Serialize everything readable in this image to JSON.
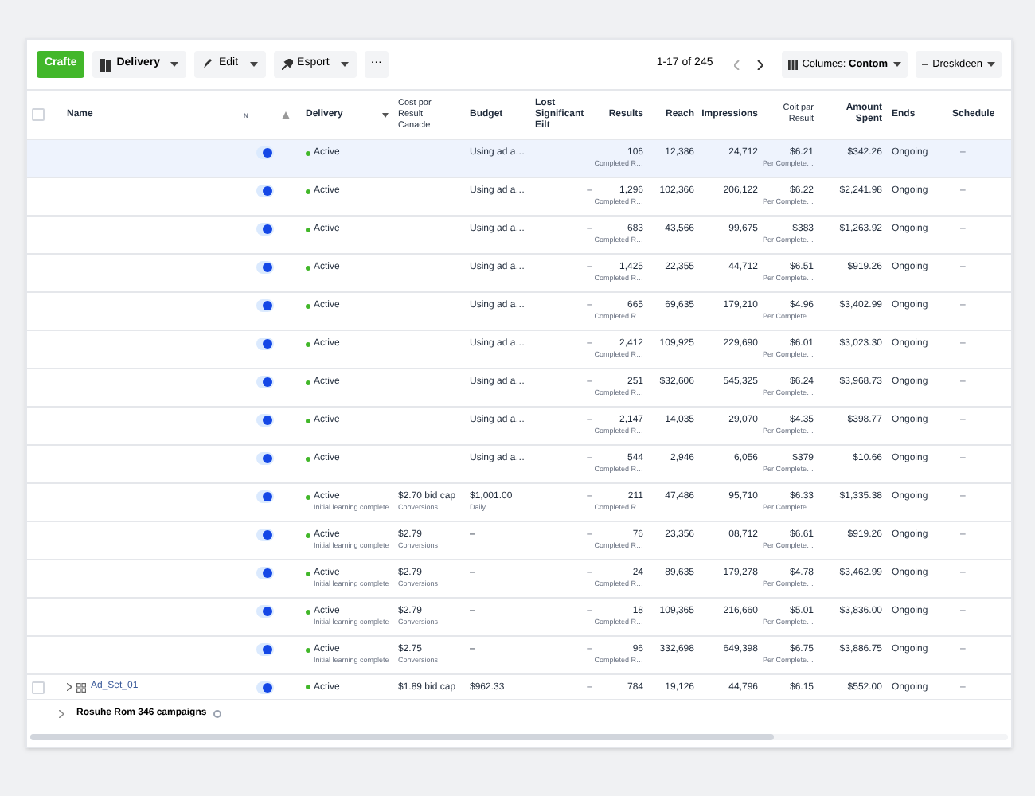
{
  "toolbar": {
    "create": "Crafte",
    "buttons": [
      {
        "kind": "doc",
        "label": "Delivery"
      },
      {
        "kind": "pencil",
        "label": "Edit"
      },
      {
        "kind": "pin",
        "label": "Esport"
      }
    ],
    "more": "···",
    "range": "1-17 of 245",
    "columns_button": "Columes: **Contom**",
    "breakdown_button": "Dreskdeen"
  },
  "columns": [
    {
      "kind": "check",
      "checked": false
    },
    {
      "kind": "text",
      "label": "Name"
    },
    {
      "kind": "text",
      "label": "N"
    },
    {
      "kind": "triangle"
    },
    {
      "kind": "sort",
      "label": "Delivery"
    },
    {
      "kind": "text",
      "label": "Cost por Result Canacle"
    },
    {
      "kind": "text",
      "label": "Budget"
    },
    {
      "kind": "text",
      "label": "Lost Significant Eilt"
    },
    {
      "kind": "text",
      "label": "Results"
    },
    {
      "kind": "text",
      "label": "Reach"
    },
    {
      "kind": "text",
      "label": "Impressions"
    },
    {
      "kind": "text",
      "label": "Coit par Result"
    },
    {
      "kind": "text",
      "label": "Amount Spent"
    },
    {
      "kind": "text",
      "label": "Ends"
    },
    {
      "kind": "text",
      "label": "Schedule"
    }
  ],
  "rows": [
    {
      "selected": true,
      "on": true,
      "delivery": "Active",
      "budget": "Using ad a…",
      "results": "106",
      "results_sub": "Completed R…",
      "reach": "12,386",
      "impressions": "24,712",
      "cpr": "$6.21",
      "cpr_sub": "Per Complete…",
      "amount": "$342.26",
      "ends": "Ongoing",
      "schedule": "–"
    },
    {
      "selected": false,
      "on": true,
      "delivery": "Active",
      "budget": "Using ad a…",
      "lost": "–",
      "results": "1,296",
      "results_sub": "Completed R…",
      "reach": "102,366",
      "impressions": "206,122",
      "cpr": "$6.22",
      "cpr_sub": "Per Complete…",
      "amount": "$2,241.98",
      "ends": "Ongoing",
      "schedule": "–"
    },
    {
      "selected": false,
      "on": true,
      "delivery": "Active",
      "budget": "Using ad a…",
      "lost": "–",
      "results": "683",
      "results_sub": "Completed R…",
      "reach": "43,566",
      "impressions": "99,675",
      "cpr": "$383",
      "cpr_sub": "Per Complete…",
      "amount": "$1,263.92",
      "ends": "Ongoing",
      "schedule": "–"
    },
    {
      "selected": false,
      "on": true,
      "delivery": "Active",
      "budget": "Using ad a…",
      "lost": "–",
      "results": "1,425",
      "results_sub": "Completed R…",
      "reach": "22,355",
      "impressions": "44,712",
      "cpr": "$6.51",
      "cpr_sub": "Per Complete…",
      "amount": "$919.26",
      "ends": "Ongoing",
      "schedule": "–"
    },
    {
      "selected": false,
      "on": true,
      "delivery": "Active",
      "budget": "Using ad a…",
      "lost": "–",
      "results": "665",
      "results_sub": "Completed R…",
      "reach": "69,635",
      "impressions": "179,210",
      "cpr": "$4.96",
      "cpr_sub": "Per Complete…",
      "amount": "$3,402.99",
      "ends": "Ongoing",
      "schedule": "–"
    },
    {
      "selected": false,
      "on": true,
      "delivery": "Active",
      "budget": "Using ad a…",
      "lost": "–",
      "results": "2,412",
      "results_sub": "Completed R…",
      "reach": "109,925",
      "impressions": "229,690",
      "cpr": "$6.01",
      "cpr_sub": "Per Complete…",
      "amount": "$3,023.30",
      "ends": "Ongoing",
      "schedule": "–"
    },
    {
      "selected": false,
      "on": true,
      "delivery": "Active",
      "budget": "Using ad a…",
      "lost": "–",
      "results": "251",
      "results_sub": "Completed R…",
      "reach": "$32,606",
      "impressions": "545,325",
      "cpr": "$6.24",
      "cpr_sub": "Per Complete…",
      "amount": "$3,968.73",
      "ends": "Ongoing",
      "schedule": "–"
    },
    {
      "selected": false,
      "on": true,
      "delivery": "Active",
      "budget": "Using ad a…",
      "lost": "–",
      "results": "2,147",
      "results_sub": "Completed R…",
      "reach": "14,035",
      "impressions": "29,070",
      "cpr": "$4.35",
      "cpr_sub": "Per Complete…",
      "amount": "$398.77",
      "ends": "Ongoing",
      "schedule": "–"
    },
    {
      "selected": false,
      "on": true,
      "delivery": "Active",
      "budget": "Using ad a…",
      "lost": "–",
      "results": "544",
      "results_sub": "Completed R…",
      "reach": "2,946",
      "impressions": "6,056",
      "cpr": "$379",
      "cpr_sub": "Per Complete…",
      "amount": "$10.66",
      "ends": "Ongoing",
      "schedule": "–"
    },
    {
      "selected": false,
      "on": true,
      "delivery": "Active",
      "delivery_sub": "Initial learning complete",
      "cost": "$2.70 bid cap",
      "cost_sub": "Conversions",
      "budget": "$1,001.00",
      "budget_sub": "Daily",
      "lost": "–",
      "results": "211",
      "results_sub": "Completed R…",
      "reach": "47,486",
      "impressions": "95,710",
      "cpr": "$6.33",
      "cpr_sub": "Per Complete…",
      "amount": "$1,335.38",
      "ends": "Ongoing",
      "schedule": "–"
    },
    {
      "selected": false,
      "on": true,
      "delivery": "Active",
      "delivery_sub": "Initial learning complete",
      "cost": "$2.79",
      "cost_sub": "Conversions",
      "budget": "–",
      "lost": "–",
      "results": "76",
      "results_sub": "Completed R…",
      "reach": "23,356",
      "impressions": "08,712",
      "cpr": "$6.61",
      "cpr_sub": "Per Complete…",
      "amount": "$919.26",
      "ends": "Ongoing",
      "schedule": "–"
    },
    {
      "selected": false,
      "on": true,
      "delivery": "Active",
      "delivery_sub": "Initial learning complete",
      "cost": "$2.79",
      "cost_sub": "Conversions",
      "budget": "–",
      "lost": "–",
      "results": "24",
      "results_sub": "Completed R…",
      "reach": "89,635",
      "impressions": "179,278",
      "cpr": "$4.78",
      "cpr_sub": "Per Complete…",
      "amount": "$3,462.99",
      "ends": "Ongoing",
      "schedule": "–"
    },
    {
      "selected": false,
      "on": true,
      "delivery": "Active",
      "delivery_sub": "Initial learning complete",
      "cost": "$2.79",
      "cost_sub": "Conversions",
      "budget": "–",
      "lost": "–",
      "results": "18",
      "results_sub": "Completed R…",
      "reach": "109,365",
      "impressions": "216,660",
      "cpr": "$5.01",
      "cpr_sub": "Per Complete…",
      "amount": "$3,836.00",
      "ends": "Ongoing",
      "schedule": "–"
    },
    {
      "selected": false,
      "on": true,
      "delivery": "Active",
      "delivery_sub": "Initial learning complete",
      "cost": "$2.75",
      "cost_sub": "Conversions",
      "budget": "–",
      "lost": "–",
      "results": "96",
      "results_sub": "Completed R…",
      "reach": "332,698",
      "impressions": "649,398",
      "cpr": "$6.75",
      "cpr_sub": "Per Complete…",
      "amount": "$3,886.75",
      "ends": "Ongoing",
      "schedule": "–"
    },
    {
      "selected": false,
      "checked": false,
      "name": "Ad_Set_01",
      "on": true,
      "delivery": "Active",
      "cost": "$1.89 bid cap",
      "budget": "$962.33",
      "lost": "–",
      "results": "784",
      "reach": "19,126",
      "impressions": "44,796",
      "cpr": "$6.15",
      "amount": "$552.00",
      "ends": "Ongoing",
      "schedule": "–"
    }
  ],
  "footer": {
    "label": "Rosuhe Rom 346 campaigns"
  }
}
